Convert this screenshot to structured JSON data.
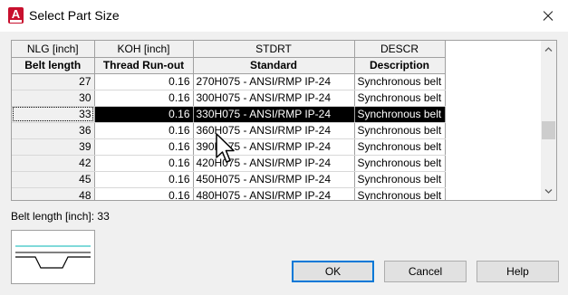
{
  "window": {
    "title": "Select Part Size",
    "app_icon_letter": "A"
  },
  "grid": {
    "header_codes": [
      "NLG [inch]",
      "KOH [inch]",
      "STDRT",
      "DESCR"
    ],
    "header_names": [
      "Belt length",
      "Thread Run-out",
      "Standard",
      "Description"
    ],
    "rows": [
      {
        "belt_length": "27",
        "thread_runout": "0.16",
        "standard": "270H075 - ANSI/RMP IP-24",
        "description": "Synchronous belt"
      },
      {
        "belt_length": "30",
        "thread_runout": "0.16",
        "standard": "300H075 - ANSI/RMP IP-24",
        "description": "Synchronous belt"
      },
      {
        "belt_length": "33",
        "thread_runout": "0.16",
        "standard": "330H075 - ANSI/RMP IP-24",
        "description": "Synchronous belt"
      },
      {
        "belt_length": "36",
        "thread_runout": "0.16",
        "standard": "360H075 - ANSI/RMP IP-24",
        "description": "Synchronous belt"
      },
      {
        "belt_length": "39",
        "thread_runout": "0.16",
        "standard": "390H075 - ANSI/RMP IP-24",
        "description": "Synchronous belt"
      },
      {
        "belt_length": "42",
        "thread_runout": "0.16",
        "standard": "420H075 - ANSI/RMP IP-24",
        "description": "Synchronous belt"
      },
      {
        "belt_length": "45",
        "thread_runout": "0.16",
        "standard": "450H075 - ANSI/RMP IP-24",
        "description": "Synchronous belt"
      },
      {
        "belt_length": "48",
        "thread_runout": "0.16",
        "standard": "480H075 - ANSI/RMP IP-24",
        "description": "Synchronous belt"
      }
    ],
    "selected_row_index": 2,
    "selection_color": "#000000"
  },
  "info": {
    "selection_label": "Belt length [inch]: 33"
  },
  "buttons": {
    "ok": "OK",
    "cancel": "Cancel",
    "help": "Help"
  },
  "icons": {
    "close": "close-icon",
    "scroll_up": "chevron-up-icon",
    "scroll_down": "chevron-down-icon",
    "cursor": "mouse-pointer-icon"
  },
  "colors": {
    "app_icon": "#c8102e",
    "preview_line": "#00b4b4",
    "default_button_border": "#0078d7"
  }
}
